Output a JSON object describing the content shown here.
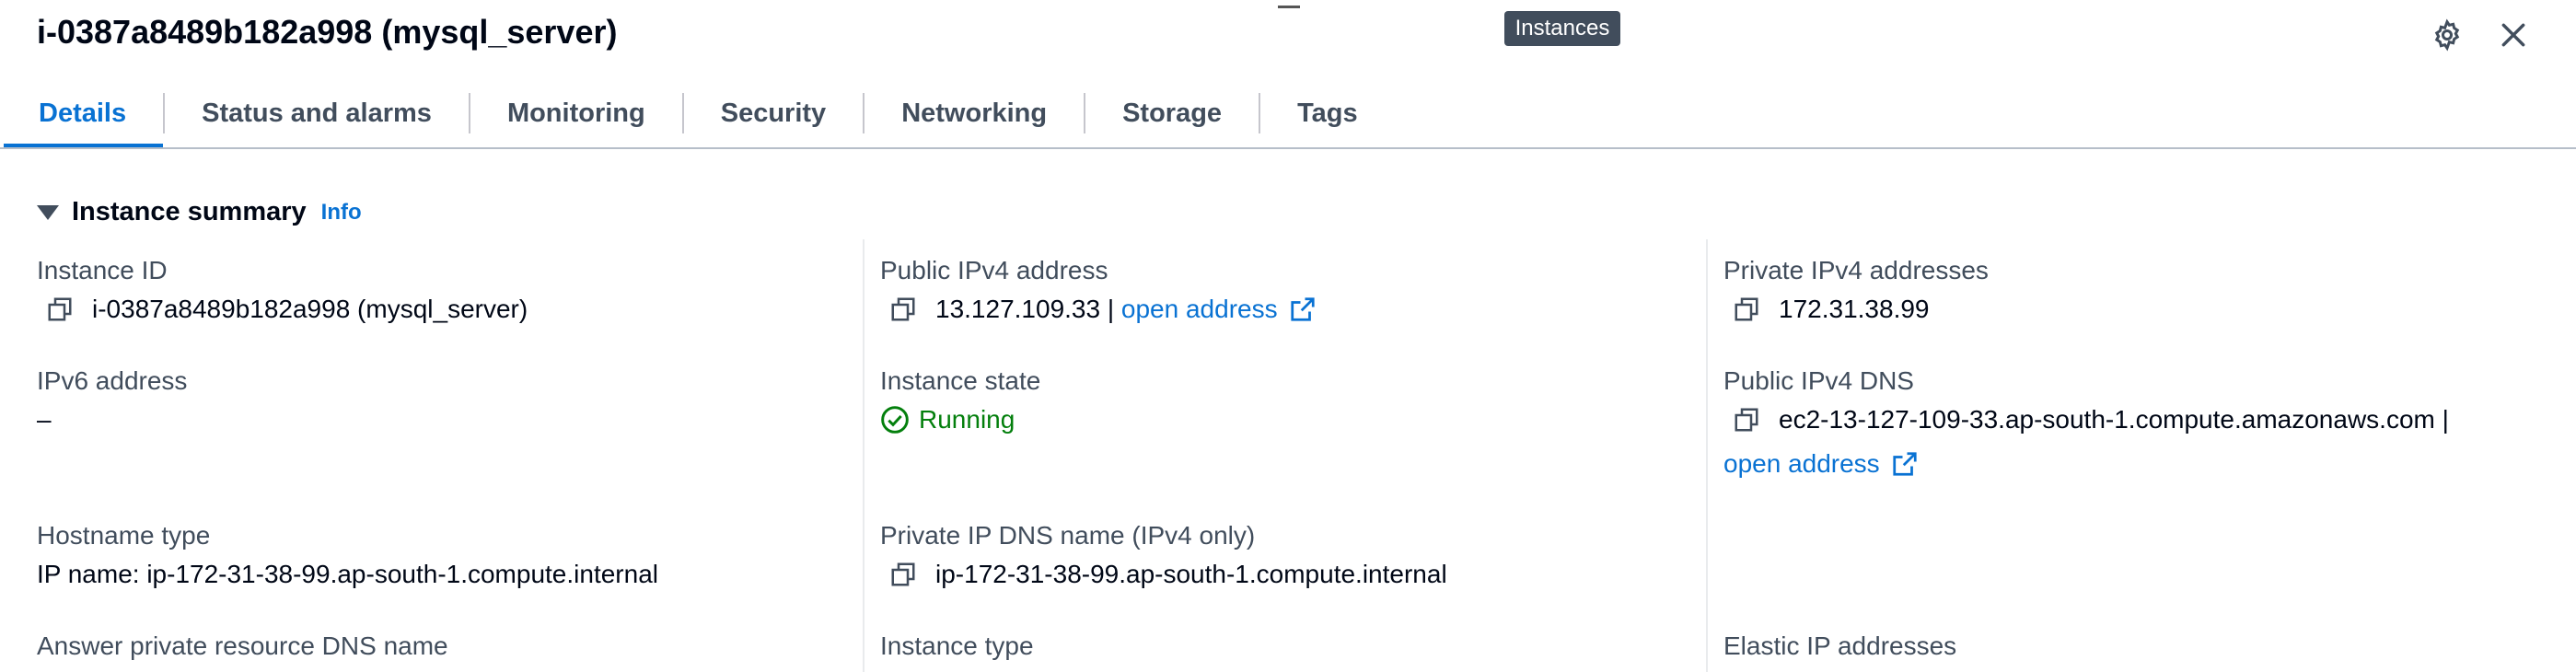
{
  "header": {
    "title": "i-0387a8489b182a998 (mysql_server)",
    "tooltip": "Instances"
  },
  "icons": {
    "settings": "gear-icon",
    "close": "close-icon",
    "copy": "copy-icon",
    "external": "external-link-icon",
    "status_ok": "status-ok-icon",
    "caret": "caret-down-icon"
  },
  "tabs": [
    {
      "label": "Details",
      "active": true
    },
    {
      "label": "Status and alarms"
    },
    {
      "label": "Monitoring"
    },
    {
      "label": "Security"
    },
    {
      "label": "Networking"
    },
    {
      "label": "Storage"
    },
    {
      "label": "Tags"
    }
  ],
  "summary": {
    "title": "Instance summary",
    "info": "Info"
  },
  "fields": {
    "instance_id": {
      "label": "Instance ID",
      "value": "i-0387a8489b182a998 (mysql_server)"
    },
    "public_ipv4": {
      "label": "Public IPv4 address",
      "value": "13.127.109.33 |",
      "link": "open address"
    },
    "private_ipv4": {
      "label": "Private IPv4 addresses",
      "value": "172.31.38.99"
    },
    "ipv6": {
      "label": "IPv6 address",
      "value": "–"
    },
    "instance_state": {
      "label": "Instance state",
      "value": "Running"
    },
    "public_dns": {
      "label": "Public IPv4 DNS",
      "value": "ec2-13-127-109-33.ap-south-1.compute.amazonaws.com |",
      "link": "open address"
    },
    "hostname_type": {
      "label": "Hostname type",
      "value": "IP name: ip-172-31-38-99.ap-south-1.compute.internal"
    },
    "private_dns": {
      "label": "Private IP DNS name (IPv4 only)",
      "value": "ip-172-31-38-99.ap-south-1.compute.internal"
    },
    "answer_dns": {
      "label": "Answer private resource DNS name"
    },
    "instance_type": {
      "label": "Instance type"
    },
    "elastic_ip": {
      "label": "Elastic IP addresses"
    }
  },
  "colors": {
    "link": "#0972d3",
    "success": "#037f0c",
    "tooltip_bg": "#414d5c"
  }
}
